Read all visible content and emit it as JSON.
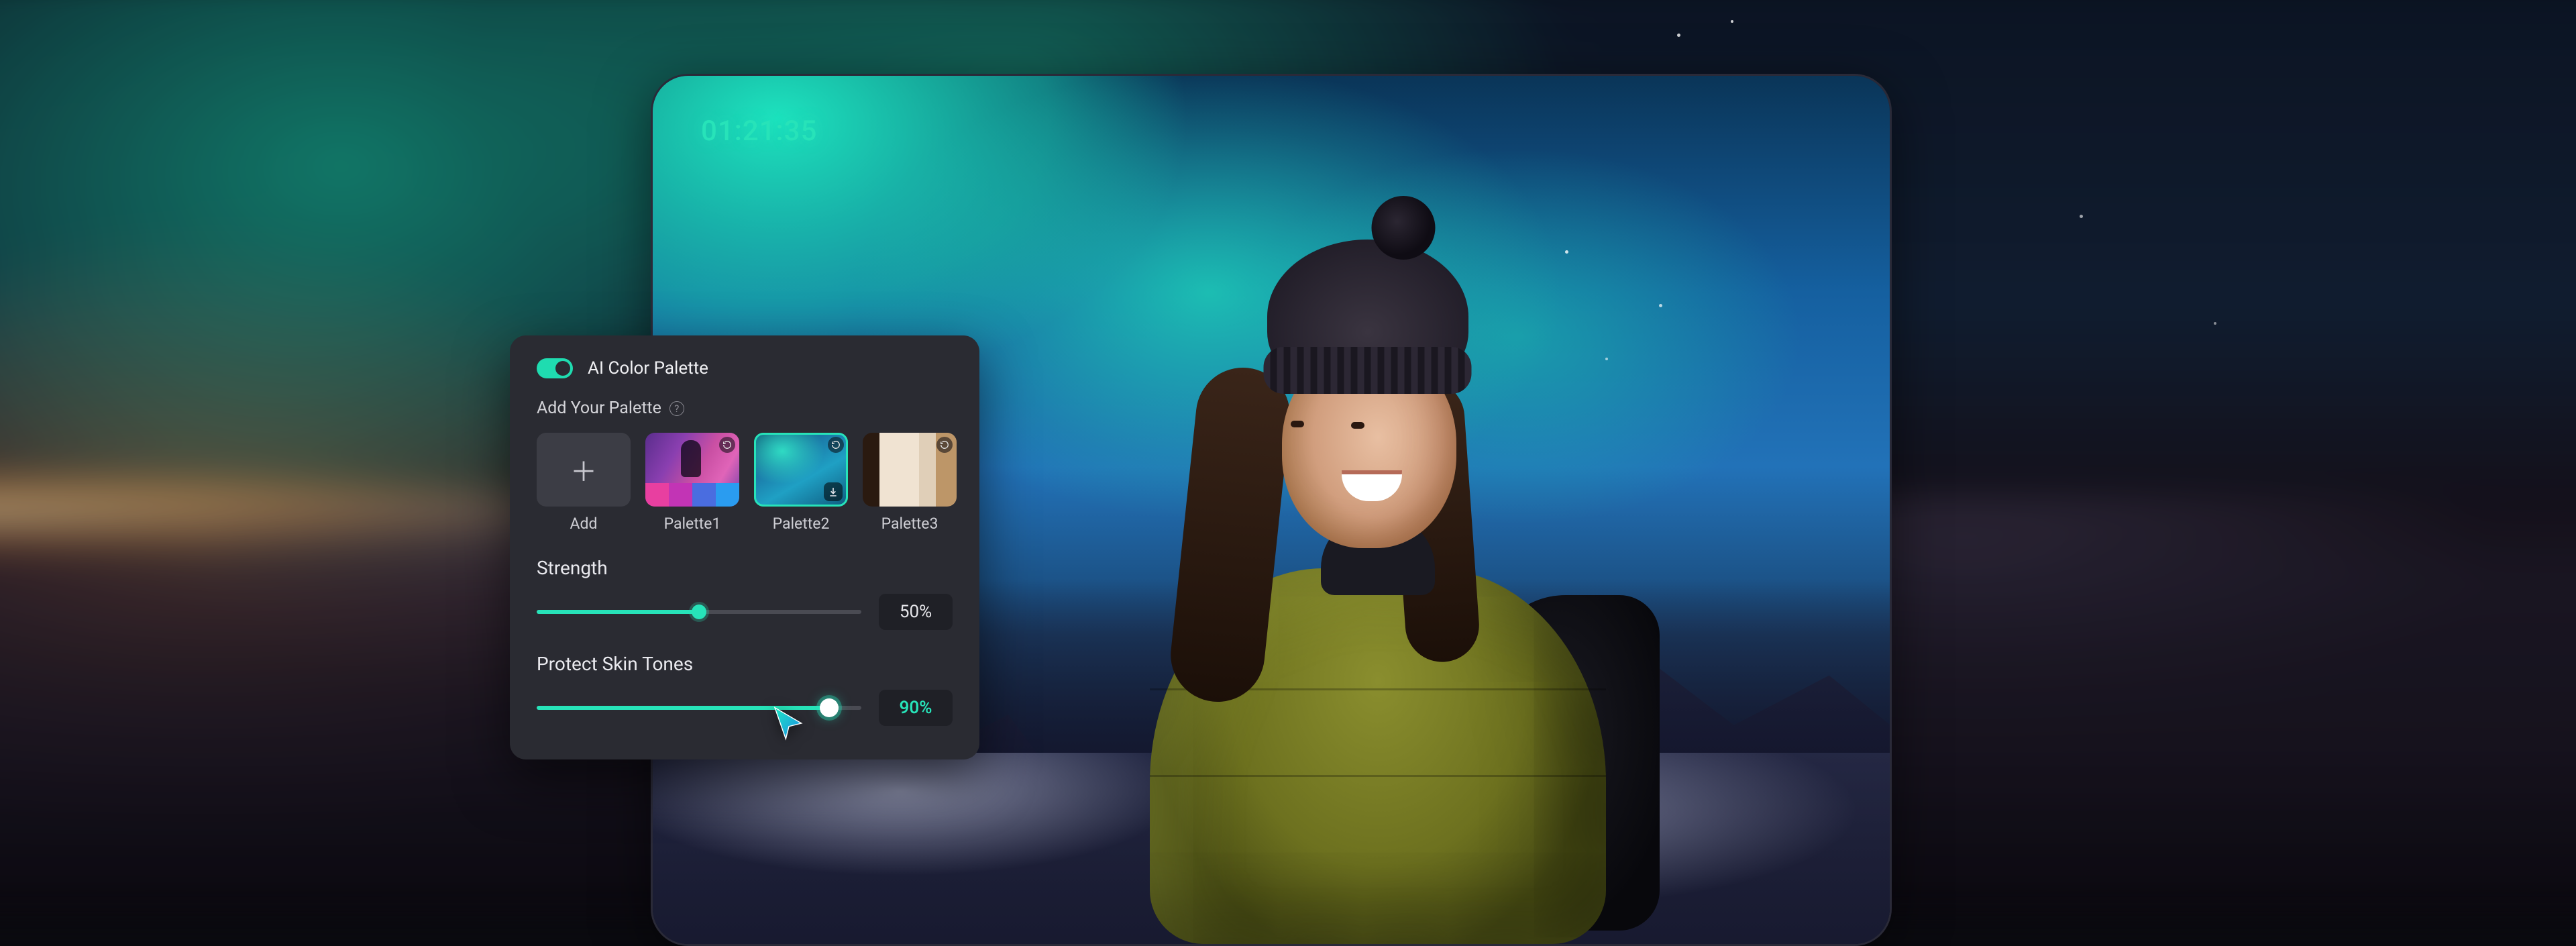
{
  "accent_color": "#27e3b9",
  "preview": {
    "timestamp": "01:21:35"
  },
  "panel": {
    "title": "AI Color Palette",
    "toggle_on": true,
    "add_section_label": "Add Your Palette",
    "add_button_label": "Add",
    "palettes": [
      {
        "label": "Palette1"
      },
      {
        "label": "Palette2"
      },
      {
        "label": "Palette3"
      }
    ],
    "strength": {
      "label": "Strength",
      "value_pct": 50,
      "value_display": "50%"
    },
    "protect_skin": {
      "label": "Protect Skin Tones",
      "value_pct": 90,
      "value_display": "90%"
    }
  }
}
